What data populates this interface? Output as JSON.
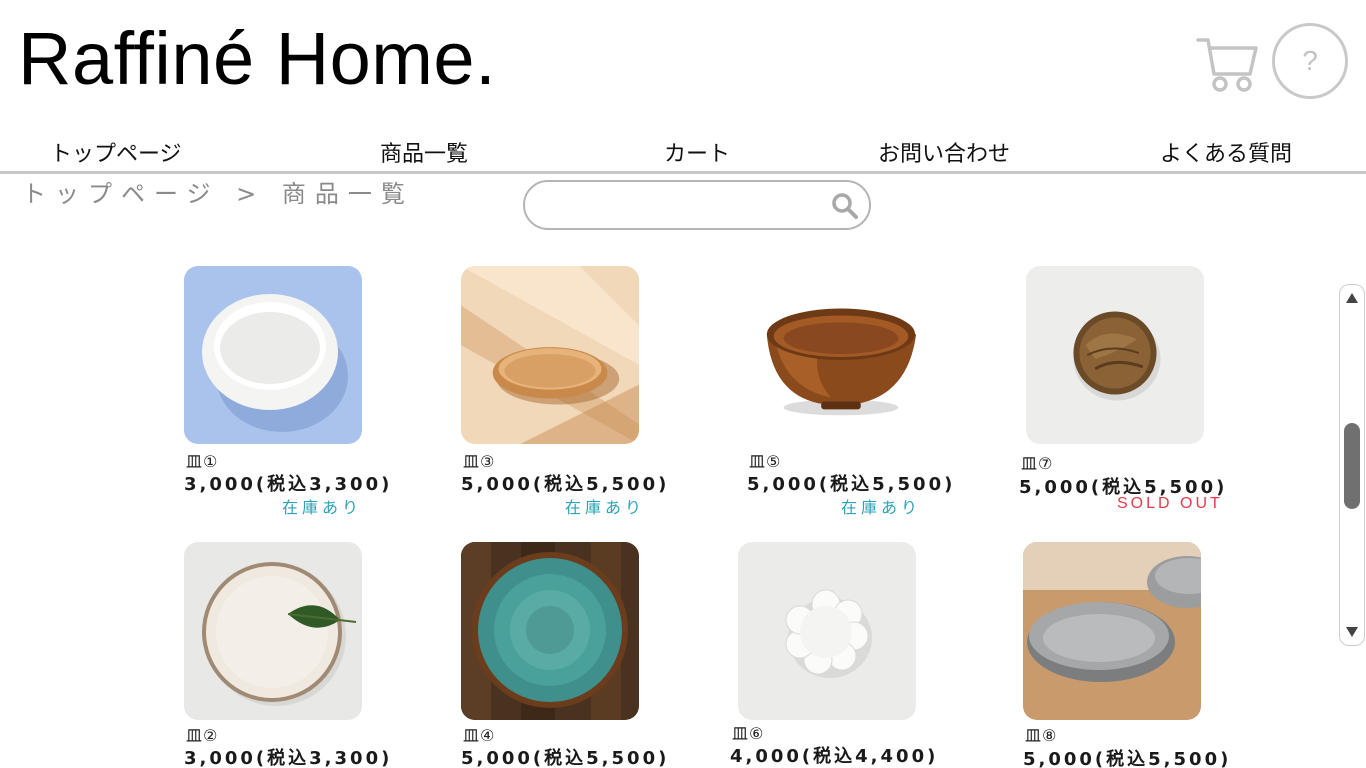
{
  "header": {
    "brand": "Raffiné Home.",
    "help_label": "?"
  },
  "nav": {
    "items": [
      {
        "label": "トップページ"
      },
      {
        "label": "商品一覧"
      },
      {
        "label": "カート"
      },
      {
        "label": "お問い合わせ"
      },
      {
        "label": "よくある質問"
      }
    ]
  },
  "breadcrumb": {
    "text": "トップページ > 商品一覧"
  },
  "search": {
    "value": "",
    "placeholder": ""
  },
  "products": [
    {
      "name": "皿①",
      "price": "3,000(税込3,300)",
      "stock": "在庫あり",
      "image": "white-oval-bowl-on-blue"
    },
    {
      "name": "皿③",
      "price": "5,000(税込5,500)",
      "stock": "在庫あり",
      "image": "wooden-tray-in-sunlight"
    },
    {
      "name": "皿⑤",
      "price": "5,000(税込5,500)",
      "stock": "在庫あり",
      "image": "wooden-bowl"
    },
    {
      "name": "皿⑦",
      "price": "5,000(税込5,500)",
      "stock": "SOLD OUT",
      "image": "small-wooden-plate"
    },
    {
      "name": "皿②",
      "price": "3,000(税込3,300)",
      "stock": "",
      "image": "cream-plate-with-leaf"
    },
    {
      "name": "皿④",
      "price": "5,000(税込5,500)",
      "stock": "",
      "image": "teal-ceramic-plate-on-wood"
    },
    {
      "name": "皿⑥",
      "price": "4,000(税込4,400)",
      "stock": "",
      "image": "white-flower-dish"
    },
    {
      "name": "皿⑧",
      "price": "5,000(税込5,500)",
      "stock": "",
      "image": "grey-stone-plate"
    }
  ],
  "colors": {
    "in_stock": "#2aa3b8",
    "sold_out": "#e53b4a",
    "divider": "#c8c8c8"
  }
}
